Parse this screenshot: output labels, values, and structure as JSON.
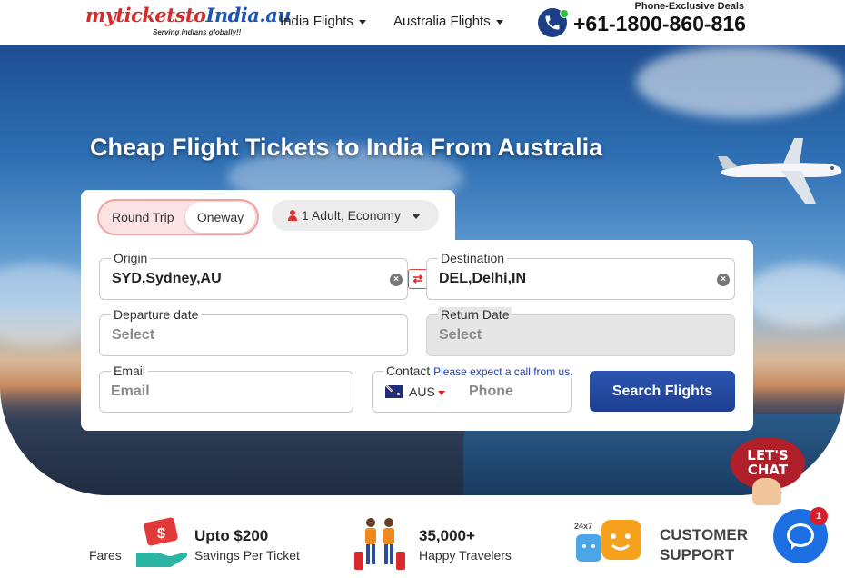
{
  "header": {
    "logo_text_1": "myticketsto",
    "logo_text_2": "India",
    "logo_text_3": ".au",
    "logo_tagline": "Serving indians globally!!",
    "nav": [
      {
        "label": "India Flights"
      },
      {
        "label": "Australia Flights"
      }
    ],
    "deals_label": "Phone-Exclusive Deals",
    "phone_number": "+61-1800-860-816"
  },
  "hero": {
    "title": "Cheap Flight Tickets to India From Australia"
  },
  "search": {
    "trip_round": "Round Trip",
    "trip_oneway": "Oneway",
    "passengers": "1 Adult, Economy",
    "origin_label": "Origin",
    "origin_value": "SYD,Sydney,AU",
    "destination_label": "Destination",
    "destination_value": "DEL,Delhi,IN",
    "departure_label": "Departure date",
    "departure_placeholder": "Select",
    "return_label": "Return Date",
    "return_placeholder": "Select",
    "email_label": "Email",
    "email_placeholder": "Email",
    "contact_label": "Contact",
    "contact_note": "Please expect a call from us.",
    "country_code": "AUS",
    "phone_placeholder": "Phone",
    "submit_label": "Search Flights"
  },
  "chat": {
    "lets_chat_1": "LET'S",
    "lets_chat_2": "CHAT",
    "unread_count": "1"
  },
  "features": {
    "fares_label": "Fares",
    "savings_title": "Upto $200",
    "savings_sub": "Savings Per Ticket",
    "travelers_title": "35,000+",
    "travelers_sub": "Happy Travelers",
    "support_line1": "CUSTOMER",
    "support_line2": "SUPPORT",
    "support_badge": "24x7"
  },
  "colors": {
    "brand_blue": "#1b3f91",
    "accent_red": "#d22a2a",
    "toggle_pink": "#fbe3e3"
  }
}
